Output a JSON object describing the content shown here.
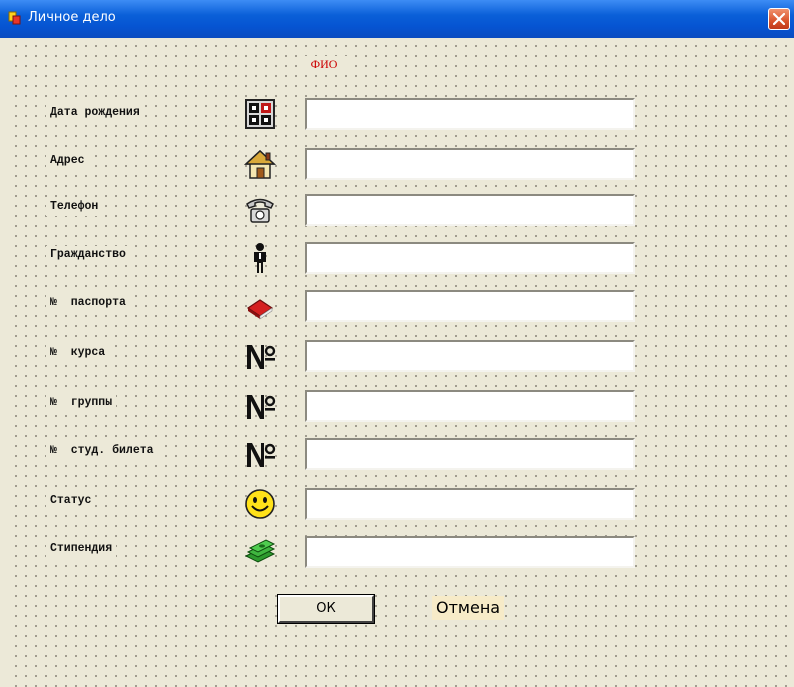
{
  "window": {
    "title": "Личное дело",
    "icon": "app-icon",
    "close_icon": "close-icon",
    "close_color": "#d9532c"
  },
  "form": {
    "heading": "ФИО",
    "heading_color": "#cc0000",
    "rows": [
      {
        "label": "Дата рождения",
        "icon": "calendar-icon",
        "value": ""
      },
      {
        "label": "Адрес",
        "icon": "house-icon",
        "value": ""
      },
      {
        "label": "Телефон",
        "icon": "telephone-icon",
        "value": ""
      },
      {
        "label": "Гражданство",
        "icon": "person-icon",
        "value": ""
      },
      {
        "label": "№  паспорта",
        "icon": "book-icon",
        "value": ""
      },
      {
        "label": "№  курса",
        "icon": "numero-icon",
        "value": ""
      },
      {
        "label": "№  группы",
        "icon": "numero-icon",
        "value": ""
      },
      {
        "label": "№  студ. билета",
        "icon": "numero-icon",
        "value": ""
      },
      {
        "label": "Статус",
        "icon": "smiley-icon",
        "value": ""
      },
      {
        "label": "Стипендия",
        "icon": "money-icon",
        "value": ""
      }
    ]
  },
  "buttons": {
    "ok_label": "ОК",
    "cancel_label": "Отмена"
  }
}
